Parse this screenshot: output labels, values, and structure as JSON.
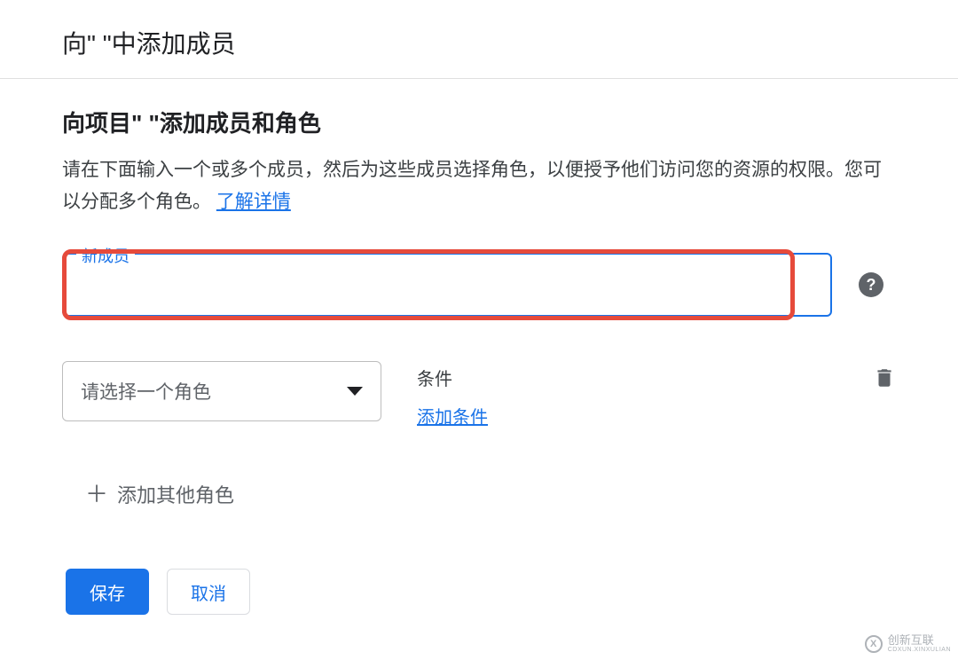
{
  "dialogTitle": "向\"                                \"中添加成员",
  "sectionTitle": "向项目\"                          \"添加成员和角色",
  "description": "请在下面输入一个或多个成员，然后为这些成员选择角色，以便授予他们访问您的资源的权限。您可以分配多个角色。",
  "learnMore": "了解详情",
  "membersField": {
    "label": "新成员",
    "value": ""
  },
  "roleSelect": {
    "placeholder": "请选择一个角色"
  },
  "condition": {
    "label": "条件",
    "addLink": "添加条件"
  },
  "addAnotherRole": "添加其他角色",
  "buttons": {
    "save": "保存",
    "cancel": "取消"
  },
  "watermark": {
    "brand": "创新互联",
    "sub": "CDXUN.XINXULIAN"
  }
}
